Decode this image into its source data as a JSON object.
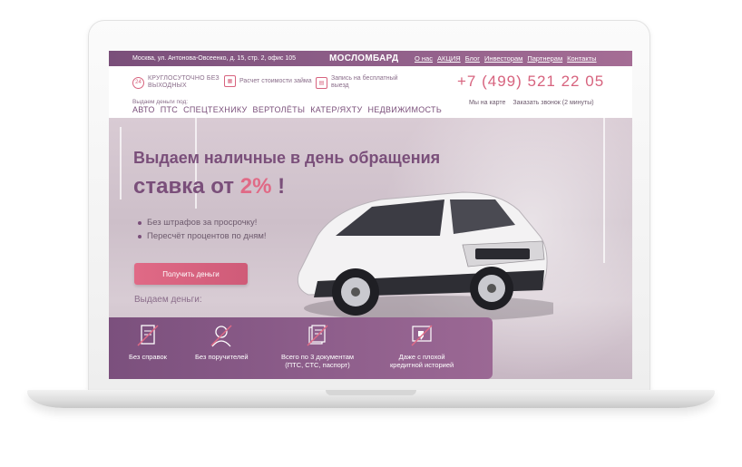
{
  "topbar": {
    "address": "Москва, ул. Антонова-Овсеенко, д. 15, стр. 2, офис 105",
    "brand": "МОСЛОМБАРД",
    "nav": [
      "О нас",
      "АКЦИЯ",
      "Блог",
      "Инвесторам",
      "Партнерам",
      "Контакты"
    ]
  },
  "header": {
    "features": [
      {
        "icon": "clock-24-icon",
        "text": "КРУГЛОСУТОЧНО БЕЗ ВЫХОДНЫХ"
      },
      {
        "icon": "calculator-icon",
        "text": "Расчет стоимости займа"
      },
      {
        "icon": "calendar-icon",
        "text": "Запись на бесплатный выезд"
      }
    ],
    "phone": "+7 (499) 521 22 05",
    "links": [
      "Мы на карте",
      "Заказать звонок (2 минуты)"
    ],
    "loan_label": "Выдаем деньги под:",
    "categories": [
      "АВТО",
      "ПТС",
      "СПЕЦТЕХНИКУ",
      "ВЕРТОЛЁТЫ",
      "КАТЕР/ЯХТУ",
      "НЕДВИЖИМОСТЬ"
    ]
  },
  "hero": {
    "title_line1": "Выдаем наличные в день обращения",
    "title_line2_prefix": "ставка от",
    "title_line2_rate": "2%",
    "title_line2_suffix": "!",
    "bullets": [
      "Без штрафов за просрочку!",
      "Пересчёт процентов по дням!"
    ],
    "cta": "Получить деньги",
    "give_label": "Выдаем деньги:"
  },
  "strip": {
    "items": [
      {
        "icon": "document-crossed-icon",
        "label": "Без справок"
      },
      {
        "icon": "person-crossed-icon",
        "label": "Без поручителей"
      },
      {
        "icon": "documents-stack-icon",
        "label": "Всего по 3 документам\n(ПТС, СТС, паспорт)"
      },
      {
        "icon": "thumbs-down-icon",
        "label": "Даже с плохой\nкредитной историей"
      }
    ]
  },
  "colors": {
    "purple": "#7a4f7a",
    "pink": "#e06a86"
  }
}
